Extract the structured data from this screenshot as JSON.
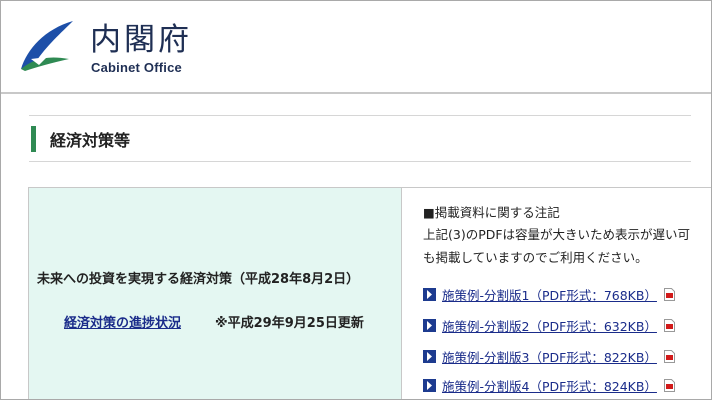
{
  "header": {
    "logo_jp": "内閣府",
    "logo_en": "Cabinet Office",
    "logo_icon": "cabinet-office-leaf-logo",
    "brand_color": "#1f2f54",
    "leaf_color": "#1d4fa8",
    "leaf_accent": "#2f8a53"
  },
  "section": {
    "title": "経済対策等",
    "accent_color": "#2f8a53"
  },
  "policy": {
    "title": "未来への投資を実現する経済対策（平成28年8月2日）",
    "progress_link": "経済対策の進捗状況",
    "update_note": "※平成29年9月25日更新",
    "cell_bg": "#e4f7f2"
  },
  "notes": {
    "heading": "■掲載資料に関する注記",
    "line1": "上記(3)のPDFは容量が大きいため表示が遅い可",
    "line2": "も掲載していますのでご利用ください。"
  },
  "files": [
    {
      "label": "施策例-分割版1（PDF形式：768KB）",
      "icon": "pdf-icon"
    },
    {
      "label": "施策例-分割版2（PDF形式：632KB）",
      "icon": "pdf-icon"
    },
    {
      "label": "施策例-分割版3（PDF形式：822KB）",
      "icon": "pdf-icon"
    },
    {
      "label": "施策例-分割版4（PDF形式：824KB）",
      "icon": "pdf-icon"
    }
  ],
  "link_color": "#1a2c8a"
}
